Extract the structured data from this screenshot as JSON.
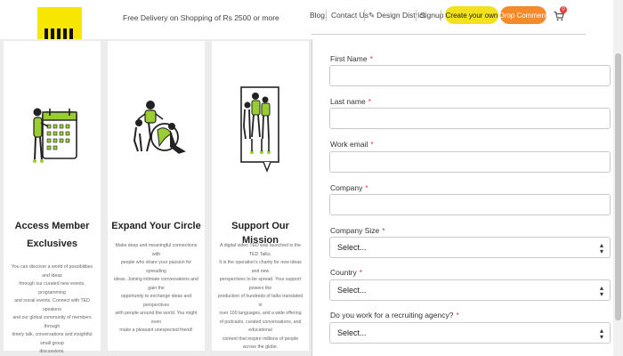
{
  "header": {
    "delivery_text": "Free Delivery on Shopping of Rs 2500 or more",
    "nav": {
      "blog": "Blog",
      "contact": "Contact Us",
      "design_district": "Design District",
      "signup": "Signup"
    },
    "create_button": "Create your own",
    "drop_button": "Drop Comment",
    "cart_count": "0",
    "colors": {
      "logo": "#f6e600",
      "create_button": "#f3e11e",
      "drop_button": "#f58a2b",
      "badge": "#e53935"
    }
  },
  "cards": [
    {
      "title_line1": "Access Member",
      "title_line2": "Exclusives",
      "body": [
        "You can discover a world of possibilities and ideas",
        "through our curated new events, programming",
        "and social events. Connect with TED speakers",
        "and our global community of members through",
        "timely talk, conversations and insightful small group",
        "discussions."
      ],
      "icon": "calendar-person-icon"
    },
    {
      "title_line1": "Expand Your Circle",
      "body": [
        "Make deep and meaningful connections with",
        "people who share your passion for spreading",
        "ideas. Joining intimate conversations and gain the",
        "opportunity to exchange ideas and perspectives",
        "with people around the world. You might even",
        "make a pleasant unexpected friend!"
      ],
      "icon": "people-circle-icon"
    },
    {
      "title_line1": "Support Our Mission",
      "body": [
        "A digital video TED was launched in the TED Talks.",
        "It is the operation's charity for new ideas and new",
        "perspectives to be spread. Your support powers the",
        "production of hundreds of talks translated in",
        "over 100 languages, and a wide offering",
        "of podcasts, curated conversations, and educational",
        "content that inspire millions of people across the globe."
      ],
      "icon": "group-board-icon"
    }
  ],
  "form": {
    "first_name_label": "First Name",
    "last_name_label": "Last name",
    "work_email_label": "Work email",
    "company_label": "Company",
    "company_size_label": "Company Size",
    "company_size_value": "Select...",
    "country_label": "Country",
    "country_value": "Select...",
    "recruiting_label": "Do you work for a recruiting agency?",
    "recruiting_value": "Select...",
    "required_mark": "*",
    "select_arrow": "▲▼"
  }
}
